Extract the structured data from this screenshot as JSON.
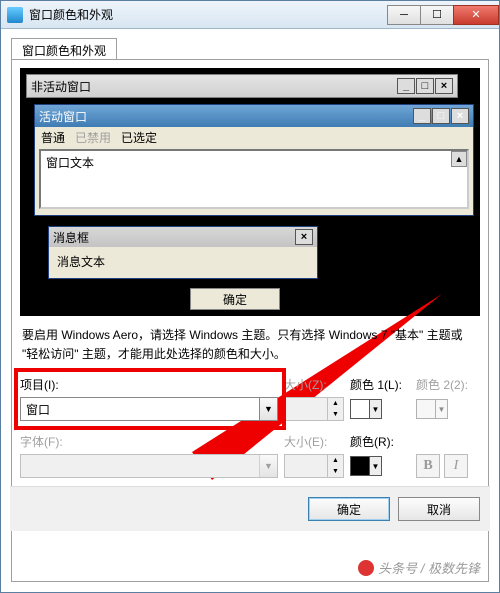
{
  "titlebar": {
    "title": "窗口颜色和外观"
  },
  "tab": {
    "label": "窗口颜色和外观"
  },
  "preview": {
    "inactive_title": "非活动窗口",
    "active_title": "活动窗口",
    "menu_normal": "普通",
    "menu_disabled": "已禁用",
    "menu_selected": "已选定",
    "window_text": "窗口文本",
    "msgbox_title": "消息框",
    "msgbox_text": "消息文本",
    "ok": "确定"
  },
  "description": "要启用 Windows Aero，请选择 Windows 主题。只有选择 Windows 7 \"基本\" 主题或 \"轻松访问\" 主题，才能用此处选择的颜色和大小。",
  "labels": {
    "item": "项目(I):",
    "size1": "大小(Z):",
    "color1": "颜色 1(L):",
    "color2": "颜色 2(2):",
    "font": "字体(F):",
    "size2": "大小(E):",
    "colorR": "颜色(R):"
  },
  "values": {
    "item": "窗口",
    "color1": "#ffffff",
    "colorR": "#000000"
  },
  "buttons": {
    "ok": "确定",
    "cancel": "取消",
    "bold": "B",
    "italic": "I"
  },
  "watermark": "头条号 / 极数先锋"
}
